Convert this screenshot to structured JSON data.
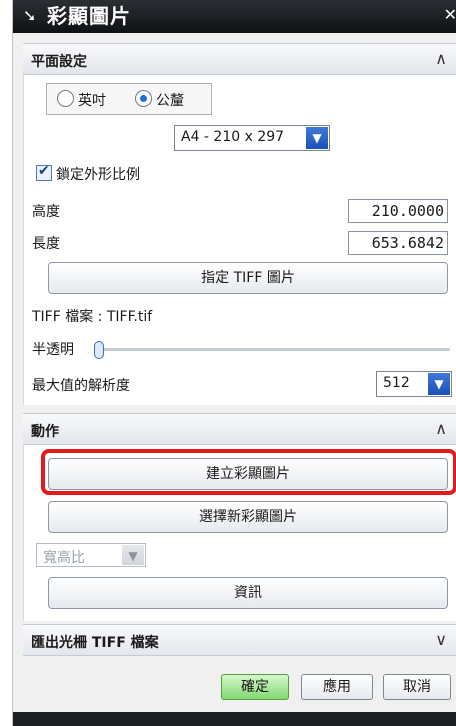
{
  "window": {
    "title": "彩顯圖片"
  },
  "sections": {
    "plane": {
      "title": "平面設定",
      "unit_inch": "英吋",
      "unit_mm": "公釐",
      "paper_size": "A4 - 210 x 297",
      "lock_ratio_label": "鎖定外形比例",
      "height_label": "高度",
      "height_value": "210.0000",
      "length_label": "長度",
      "length_value": "653.6842",
      "specify_tiff_button": "指定 TIFF 圖片",
      "tiff_file_label": "TIFF 檔案 : TIFF.tif",
      "translucency_label": "半透明",
      "translucency_level": 0.0,
      "max_resolution_label": "最大值的解析度",
      "max_resolution_value": "512"
    },
    "action": {
      "title": "動作",
      "create_button": "建立彩顯圖片",
      "select_new_button": "選擇新彩顯圖片",
      "aspect_select": "寬高比",
      "info_button": "資訊"
    },
    "export": {
      "title": "匯出光柵 TIFF 檔案"
    }
  },
  "footer": {
    "ok": "確定",
    "apply": "應用",
    "cancel": "取消"
  },
  "colors": {
    "highlight": "#e31a1a",
    "accent": "#1f6fd6",
    "ok_button": "#84d771"
  }
}
